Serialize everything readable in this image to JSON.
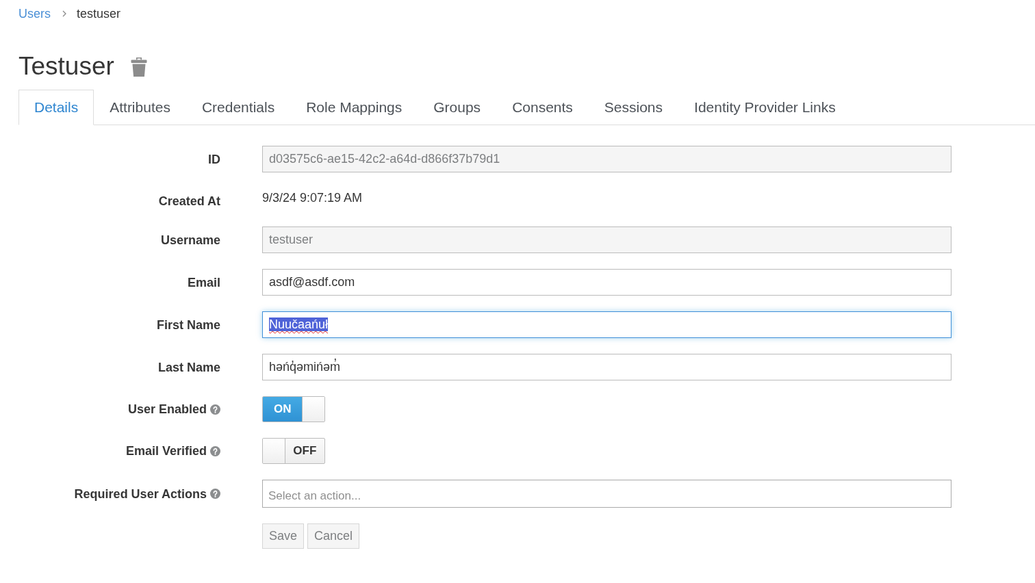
{
  "breadcrumb": [
    {
      "label": "Users",
      "kind": "link"
    },
    {
      "label": "testuser",
      "kind": "current"
    }
  ],
  "title": "Testuser",
  "tabs": [
    {
      "label": "Details",
      "selected": true
    },
    {
      "label": "Attributes",
      "selected": false
    },
    {
      "label": "Credentials",
      "selected": false
    },
    {
      "label": "Role Mappings",
      "selected": false
    },
    {
      "label": "Groups",
      "selected": false
    },
    {
      "label": "Consents",
      "selected": false
    },
    {
      "label": "Sessions",
      "selected": false
    },
    {
      "label": "Identity Provider Links",
      "selected": false
    }
  ],
  "fields": [
    {
      "kind": "input",
      "label": "ID",
      "help": false,
      "value": "d03575c6-ae15-42c2-a64d-d866f37b79d1",
      "disabled": true,
      "focused": false,
      "text_selected": false,
      "misspelled": false
    },
    {
      "kind": "text",
      "label": "Created At",
      "help": false,
      "value": "9/3/24 9:07:19 AM"
    },
    {
      "kind": "input",
      "label": "Username",
      "help": false,
      "value": "testuser",
      "disabled": true,
      "focused": false,
      "text_selected": false,
      "misspelled": false
    },
    {
      "kind": "input",
      "label": "Email",
      "help": false,
      "value": "asdf@asdf.com",
      "disabled": false,
      "focused": false,
      "text_selected": false,
      "misspelled": false
    },
    {
      "kind": "input",
      "label": "First Name",
      "help": false,
      "value": "Nuučaańuł",
      "disabled": false,
      "focused": true,
      "text_selected": true,
      "misspelled": true
    },
    {
      "kind": "input",
      "label": "Last Name",
      "help": false,
      "value": "həńq̓əmińəm̓",
      "disabled": false,
      "focused": false,
      "text_selected": false,
      "misspelled": false
    },
    {
      "kind": "switch",
      "label": "User Enabled",
      "help": true,
      "on": true,
      "text": "ON"
    },
    {
      "kind": "switch",
      "label": "Email Verified",
      "help": true,
      "on": false,
      "text": "OFF"
    },
    {
      "kind": "select",
      "label": "Required User Actions",
      "help": true,
      "placeholder": "Select an action..."
    }
  ],
  "buttons": [
    {
      "label": "Save",
      "disabled": true
    },
    {
      "label": "Cancel",
      "disabled": true
    }
  ]
}
